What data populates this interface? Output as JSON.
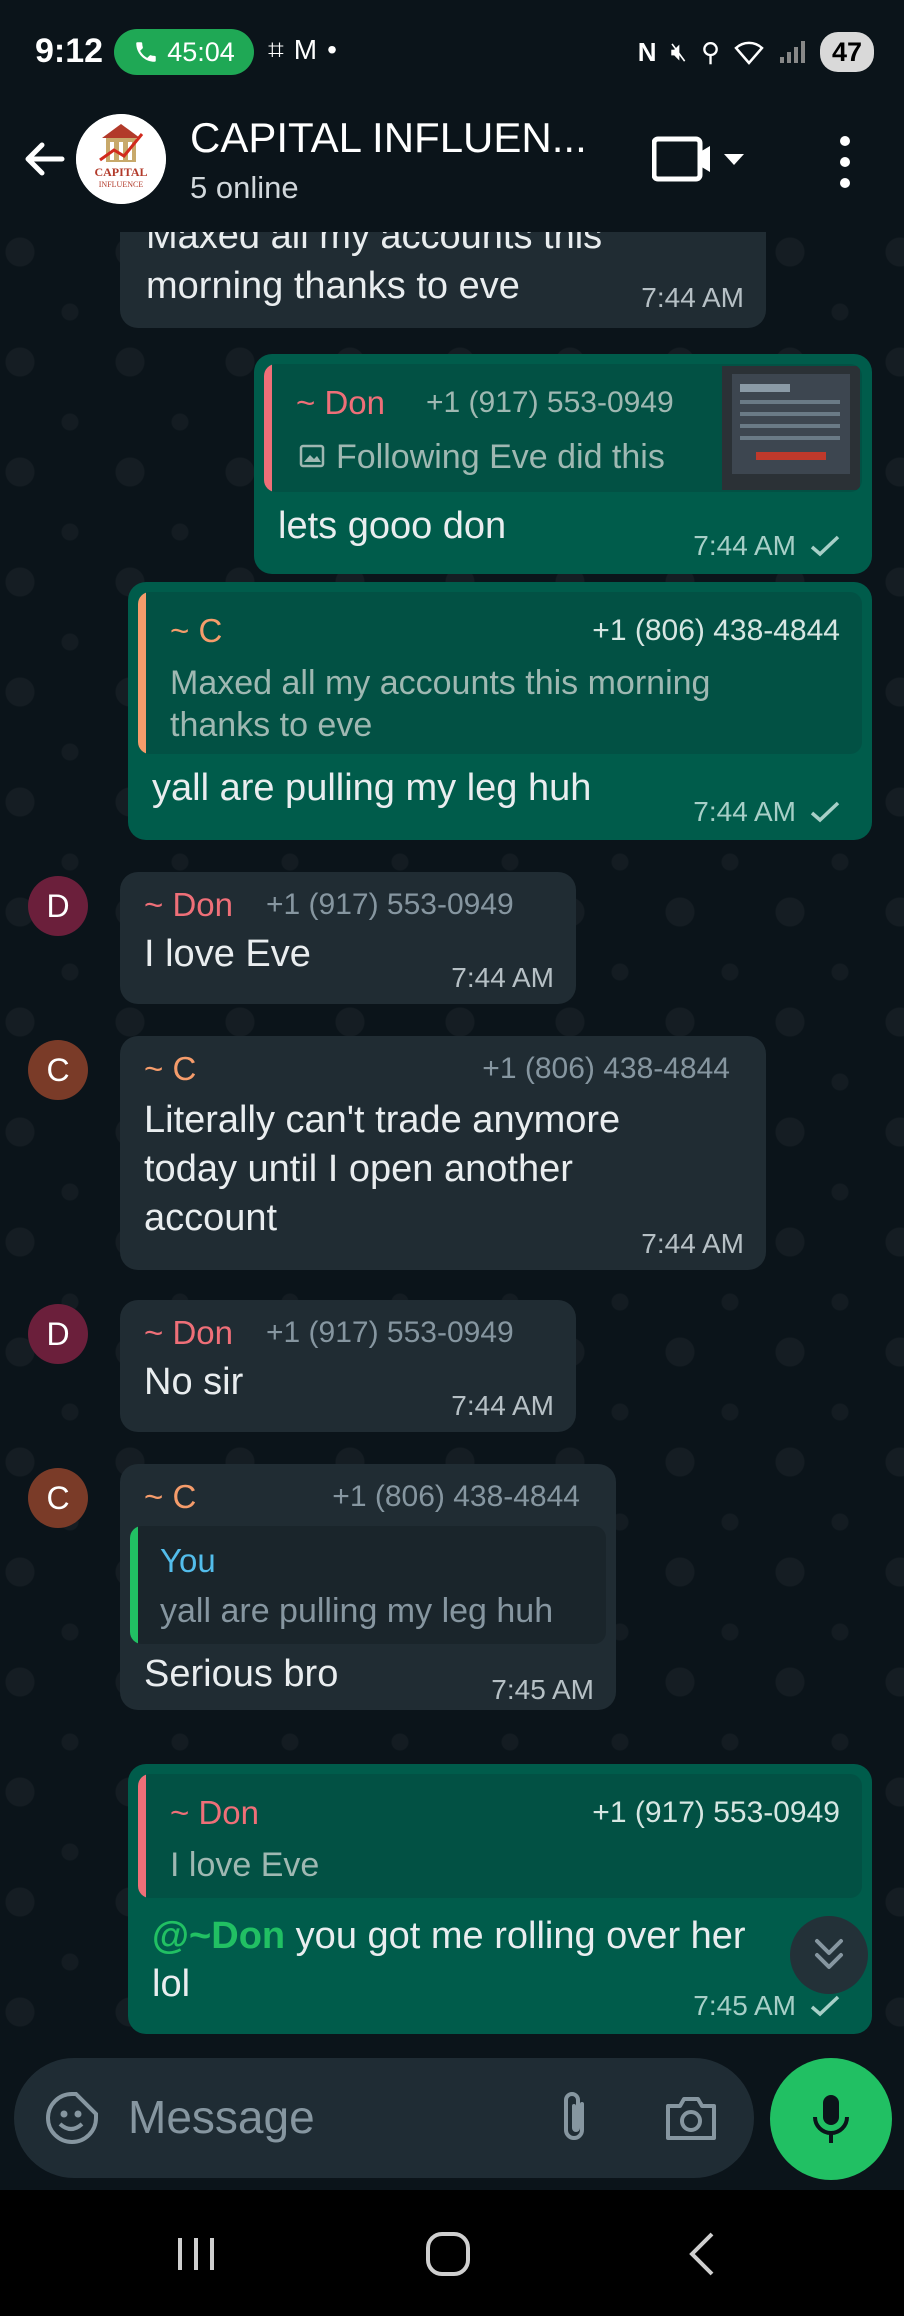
{
  "status_bar": {
    "time": "9:12",
    "call_duration": "45:04",
    "battery": "47"
  },
  "header": {
    "title": "CAPITAL INFLUEN...",
    "subtitle": "5 online",
    "avatar_text": [
      "CAPITAL",
      "INFLUENCE"
    ]
  },
  "messages": [
    {
      "type": "in-cut",
      "text_lines": [
        "Maxed all my accounts this",
        "morning thanks to eve"
      ],
      "time": "7:44 AM"
    },
    {
      "type": "out",
      "quote": {
        "sender": "~ Don",
        "phone": "+1 (917) 553-0949",
        "text": "Following Eve did this"
      },
      "text": "lets gooo don",
      "time": "7:44 AM"
    },
    {
      "type": "out",
      "quote": {
        "sender": "~ C",
        "phone": "+1 (806) 438-4844",
        "text_lines": [
          "Maxed all my accounts this morning",
          "thanks to eve"
        ]
      },
      "text": "yall are pulling my leg huh",
      "time": "7:44 AM"
    },
    {
      "type": "in",
      "avatar": "D",
      "sender": "~ Don",
      "phone": "+1 (917) 553-0949",
      "text": "I love Eve",
      "time": "7:44 AM"
    },
    {
      "type": "in",
      "avatar": "C",
      "sender": "~ C",
      "phone": "+1 (806) 438-4844",
      "text_lines": [
        "Literally can't trade anymore",
        "today until I open another",
        "account"
      ],
      "time": "7:44 AM"
    },
    {
      "type": "in",
      "avatar": "D",
      "sender": "~ Don",
      "phone": "+1 (917) 553-0949",
      "text": "No sir",
      "time": "7:44 AM"
    },
    {
      "type": "in",
      "avatar": "C",
      "sender": "~ C",
      "phone": "+1 (806) 438-4844",
      "quote": {
        "sender": "You",
        "text": "yall are pulling my leg huh"
      },
      "text": "Serious bro",
      "time": "7:45 AM"
    },
    {
      "type": "out",
      "quote": {
        "sender": "~ Don",
        "phone": "+1 (917) 553-0949",
        "text": "I love Eve"
      },
      "mention": "@~Don",
      "text_rest": " you got me rolling over her",
      "text_line2": "lol",
      "time": "7:45 AM"
    }
  ],
  "composer": {
    "placeholder": "Message"
  },
  "colors": {
    "background": "#0b141a",
    "incoming_bubble": "#202c33",
    "outgoing_bubble": "#005c4b",
    "accent_green": "#21c063",
    "don_name": "#ef6f78",
    "c_name": "#f59c6b",
    "you_name": "#53bdeb"
  },
  "icons": {
    "back": "arrow-left-icon",
    "video": "video-call-icon",
    "more": "more-vert-icon",
    "emoji": "sticker-icon",
    "attach": "paperclip-icon",
    "camera": "camera-icon",
    "mic": "microphone-icon",
    "scroll": "double-chevron-down-icon"
  }
}
